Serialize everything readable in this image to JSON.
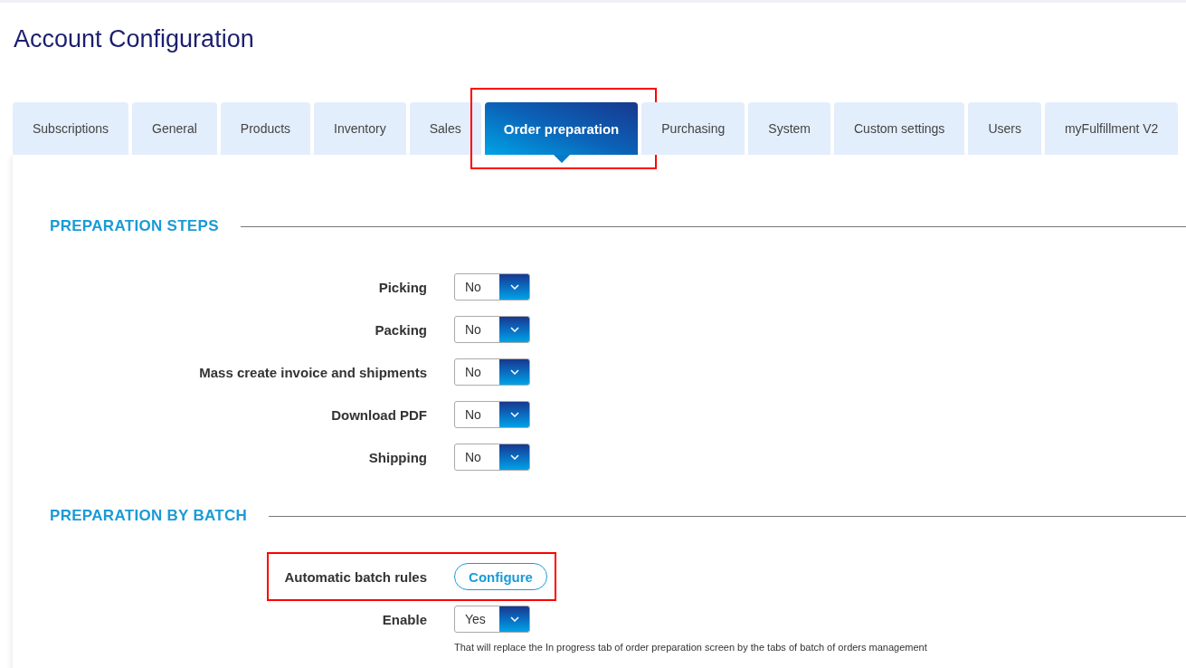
{
  "page": {
    "title": "Account Configuration"
  },
  "tabs": [
    {
      "label": "Subscriptions",
      "selected": false,
      "highlighted": false
    },
    {
      "label": "General",
      "selected": false,
      "highlighted": false
    },
    {
      "label": "Products",
      "selected": false,
      "highlighted": false
    },
    {
      "label": "Inventory",
      "selected": false,
      "highlighted": false
    },
    {
      "label": "Sales",
      "selected": false,
      "highlighted": false
    },
    {
      "label": "Order preparation",
      "selected": true,
      "highlighted": true
    },
    {
      "label": "Purchasing",
      "selected": false,
      "highlighted": false
    },
    {
      "label": "System",
      "selected": false,
      "highlighted": false
    },
    {
      "label": "Custom settings",
      "selected": false,
      "highlighted": false
    },
    {
      "label": "Users",
      "selected": false,
      "highlighted": false
    },
    {
      "label": "myFulfillment V2",
      "selected": false,
      "highlighted": false
    }
  ],
  "sections": [
    {
      "title": "PREPARATION STEPS",
      "rows": [
        {
          "kind": "select",
          "label": "Picking",
          "value": "No",
          "highlighted": false
        },
        {
          "kind": "select",
          "label": "Packing",
          "value": "No",
          "highlighted": false
        },
        {
          "kind": "select",
          "label": "Mass create invoice and shipments",
          "value": "No",
          "highlighted": false
        },
        {
          "kind": "select",
          "label": "Download PDF",
          "value": "No",
          "highlighted": false
        },
        {
          "kind": "select",
          "label": "Shipping",
          "value": "No",
          "highlighted": false
        }
      ]
    },
    {
      "title": "PREPARATION BY BATCH",
      "rows": [
        {
          "kind": "button",
          "label": "Automatic batch rules",
          "button": "Configure",
          "highlighted": true
        },
        {
          "kind": "select",
          "label": "Enable",
          "value": "Yes",
          "highlighted": false,
          "hint": "That will replace the In progress tab of order preparation screen by the tabs of batch of orders management"
        }
      ]
    }
  ]
}
